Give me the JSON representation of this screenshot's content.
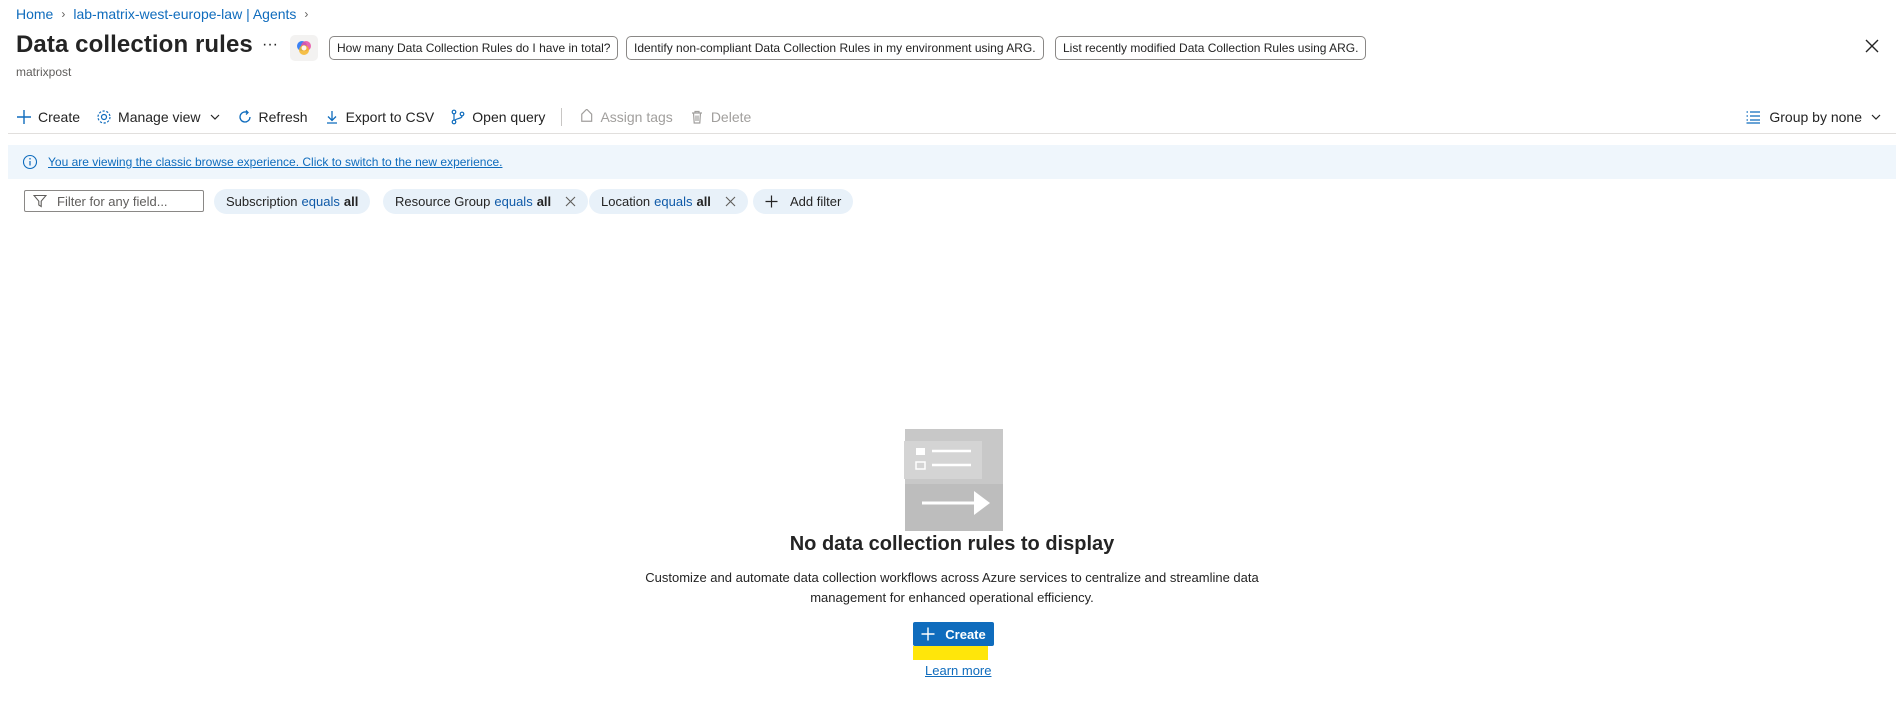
{
  "breadcrumb": {
    "items": [
      {
        "label": "Home"
      },
      {
        "label": "lab-matrix-west-europe-law | Agents"
      }
    ]
  },
  "header": {
    "title": "Data collection rules",
    "subtitle": "matrixpost",
    "more_label": "···",
    "suggestions": [
      "How many Data Collection Rules do I have in total?",
      "Identify non-compliant Data Collection Rules in my environment using ARG.",
      "List recently modified Data Collection Rules using ARG."
    ]
  },
  "toolbar": {
    "create": "Create",
    "manage_view": "Manage view",
    "refresh": "Refresh",
    "export_csv": "Export to CSV",
    "open_query": "Open query",
    "assign_tags": "Assign tags",
    "delete": "Delete",
    "group_by": "Group by none"
  },
  "banner": {
    "text": "You are viewing the classic browse experience. Click to switch to the new experience."
  },
  "filters": {
    "search_placeholder": "Filter for any field...",
    "pills": [
      {
        "key": "Subscription",
        "op": "equals",
        "value": "all",
        "removable": false
      },
      {
        "key": "Resource Group",
        "op": "equals",
        "value": "all",
        "removable": true
      },
      {
        "key": "Location",
        "op": "equals",
        "value": "all",
        "removable": true
      }
    ],
    "add_filter": "Add filter"
  },
  "empty_state": {
    "title": "No data collection rules to display",
    "description": "Customize and automate data collection workflows across Azure services to centralize and streamline data management for enhanced operational efficiency.",
    "create_label": "Create",
    "learn_more": "Learn more"
  },
  "colors": {
    "accent": "#0f6cbd",
    "banner_bg": "#eff6fc",
    "pill_bg": "#e8f1f9",
    "highlight": "#ffe60a"
  }
}
